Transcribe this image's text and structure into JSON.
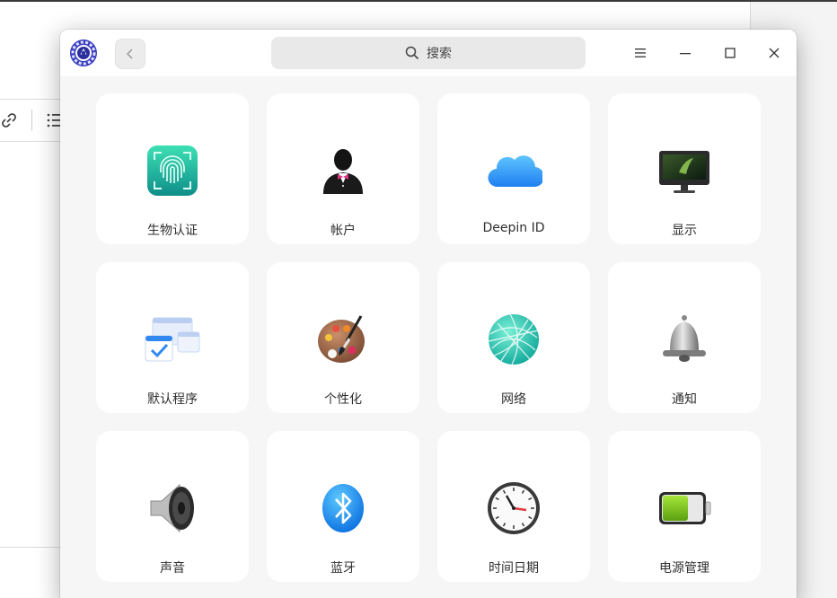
{
  "window": {
    "search_placeholder": "搜索"
  },
  "modules": [
    {
      "key": "biometric",
      "label": "生物认证"
    },
    {
      "key": "accounts",
      "label": "帐户"
    },
    {
      "key": "deepin-id",
      "label": "Deepin ID"
    },
    {
      "key": "display",
      "label": "显示"
    },
    {
      "key": "default-apps",
      "label": "默认程序"
    },
    {
      "key": "personalization",
      "label": "个性化"
    },
    {
      "key": "network",
      "label": "网络"
    },
    {
      "key": "notification",
      "label": "通知"
    },
    {
      "key": "sound",
      "label": "声音"
    },
    {
      "key": "bluetooth",
      "label": "蓝牙"
    },
    {
      "key": "datetime",
      "label": "时间日期"
    },
    {
      "key": "power",
      "label": "电源管理"
    }
  ],
  "icons": {
    "app": "settings-gear-icon",
    "back": "chevron-left-icon",
    "search": "search-icon",
    "menu": "hamburger-menu-icon",
    "minimize": "minimize-icon",
    "maximize": "maximize-icon",
    "close": "close-icon"
  },
  "colors": {
    "window_bg": "#f6f6f6",
    "tile_bg": "#ffffff",
    "accent_blue": "#1e8ff0",
    "battery_green": "#7cc420"
  }
}
